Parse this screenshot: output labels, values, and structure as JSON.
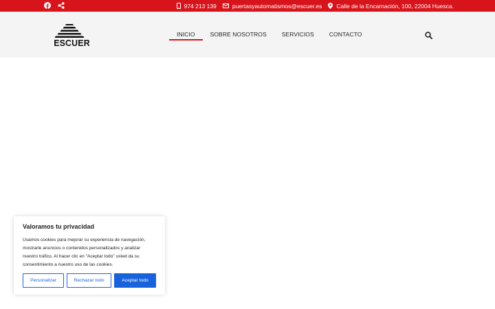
{
  "topbar": {
    "icons": [
      "facebook-icon",
      "share-icon",
      "phone-icon",
      "mail-icon",
      "location-icon"
    ],
    "phone": "974 213 139",
    "email": "puertasyautomatismos@escuer.es",
    "address": "Calle de la Encarnación, 100, 22004 Huesca."
  },
  "header": {
    "logo_text": "ESCUER",
    "nav": [
      {
        "label": "INICIO"
      },
      {
        "label": "SOBRE NOSOTROS"
      },
      {
        "label": "SERVICIOS"
      },
      {
        "label": "CONTACTO"
      }
    ],
    "active_nav": "INICIO"
  },
  "cookie_banner": {
    "title": "Valoramos tu privacidad",
    "body": "Usamos cookies para mejorar su experiencia de navegación, mostrarle anuncios o contenidos personalizados y analizar nuestro tráfico. Al hacer clic en \"Aceptar todo\" usted da su consentimiento a nuestro uso de las cookies.",
    "customize_label": "Personalizar",
    "reject_label": "Rechazar todo",
    "accept_label": "Aceptar todo"
  },
  "colors": {
    "brand_red": "#d7141b",
    "cookie_blue": "#1863dc",
    "header_bg": "#f4f4f4"
  }
}
